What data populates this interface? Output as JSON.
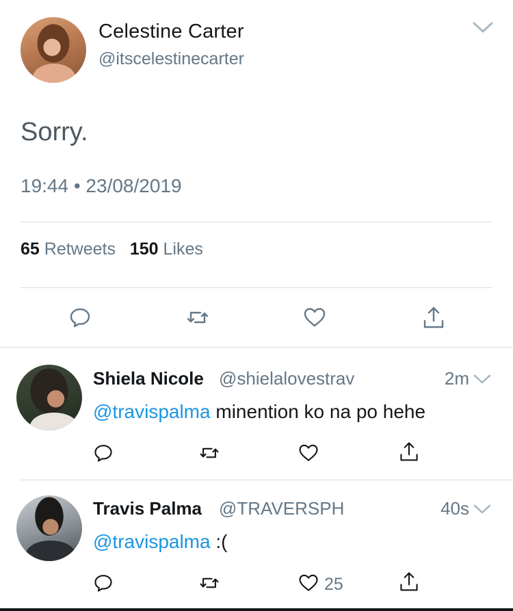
{
  "tweet": {
    "author_name": "Celestine Carter",
    "author_handle": "@itscelestinecarter",
    "text": "Sorry.",
    "timestamp": "19:44 • 23/08/2019",
    "retweets_count": "65",
    "retweets_label": "Retweets",
    "likes_count": "150",
    "likes_label": "Likes"
  },
  "replies": [
    {
      "name": "Shiela Nicole",
      "handle": "@shielalovestrav",
      "time": "2m",
      "mention": "@travispalma",
      "text": " minention ko na po hehe",
      "likes": ""
    },
    {
      "name": "Travis Palma",
      "handle": "@TRAVERSPH",
      "time": "40s",
      "mention": "@travispalma",
      "text": " :(",
      "likes": "25"
    }
  ],
  "icons": {
    "reply": "speech-bubble-icon",
    "retweet": "retweet-icon",
    "like": "heart-icon",
    "share": "share-icon",
    "more": "chevron-down-icon"
  },
  "colors": {
    "mention": "#1b95e0",
    "muted": "#657786",
    "divider": "#d7dde2",
    "text": "#14171a"
  }
}
